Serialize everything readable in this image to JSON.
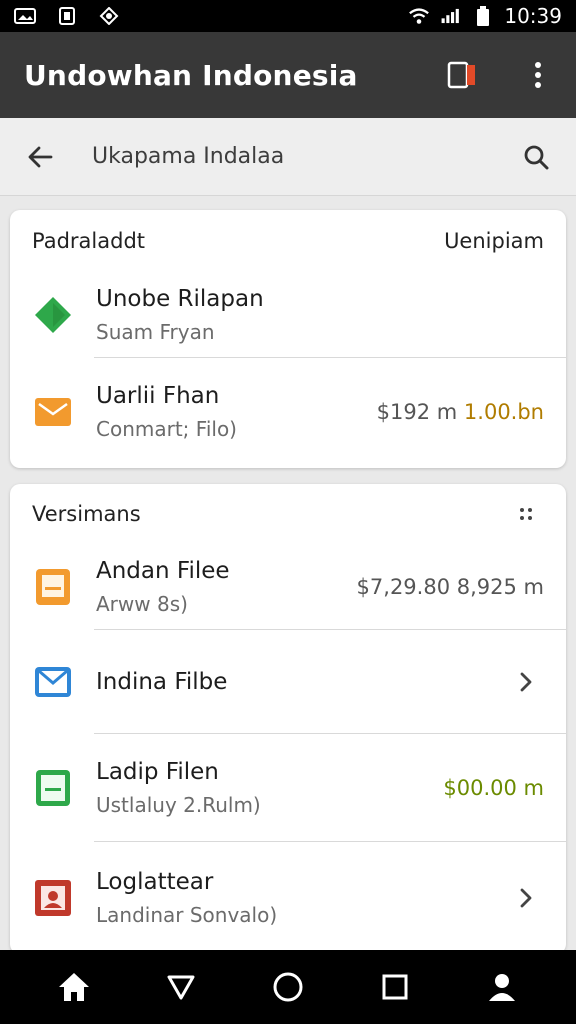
{
  "status_bar": {
    "time": "10:39",
    "icons": [
      "image-icon",
      "sim-icon",
      "notification-icon",
      "wifi-icon",
      "signal-icon",
      "battery-icon"
    ]
  },
  "app_bar": {
    "title": "Undowhan Indonesia",
    "icons": [
      "book-icon",
      "more-vert-icon"
    ],
    "accent_color": "#e24a28"
  },
  "search": {
    "text": "Ukapama Indalaa"
  },
  "card1": {
    "title": "Padraladdt",
    "action": "Uenipiam",
    "rows": [
      {
        "icon": "green-tag-icon",
        "primary": "Unobe Rilapan",
        "secondary": "Suam Fryan",
        "trail": ""
      },
      {
        "icon": "orange-mail-icon",
        "primary": "Uarlii Fhan",
        "secondary": "Conmart; Filo)",
        "trail_a": "$192 m",
        "trail_b": "1.00.bn"
      }
    ]
  },
  "card2": {
    "title": "Versimans",
    "rows": [
      {
        "icon": "orange-document-icon",
        "primary": "Andan Filee",
        "secondary": "Arww 8s)",
        "trail": "$7,29.80 8,925 m"
      },
      {
        "icon": "blue-mail-icon",
        "primary": "Indina Filbe",
        "secondary": "",
        "trail": ""
      },
      {
        "icon": "green-document-icon",
        "primary": "Ladip Filen",
        "secondary": "Ustlaluy 2.Rulm)",
        "trail": "$00.00 m"
      },
      {
        "icon": "red-contact-icon",
        "primary": "Loglattear",
        "secondary": "Landinar Sonvalo)",
        "trail": ""
      }
    ]
  },
  "nav": {
    "items": [
      "home-icon",
      "back-icon",
      "circle-home-icon",
      "recents-icon",
      "profile-icon"
    ]
  },
  "colors": {
    "green": "#2ea84a",
    "orange": "#f29a2e",
    "blue": "#2f86d6",
    "red": "#c0392b",
    "money_green": "#6b8b00"
  }
}
